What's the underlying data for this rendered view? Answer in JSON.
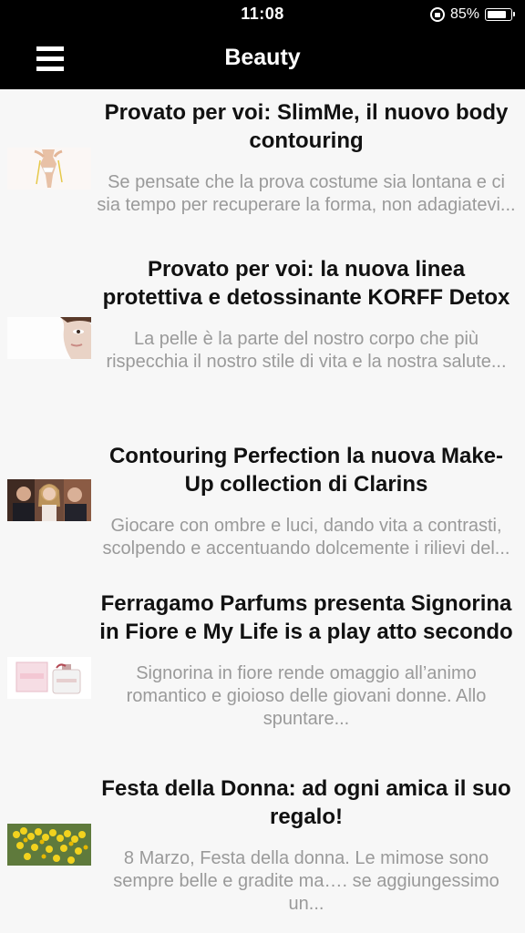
{
  "status_bar": {
    "time": "11:08",
    "battery_percent": "85%",
    "battery_level": 0.85,
    "icons": [
      "rotation-lock-icon",
      "battery-icon"
    ]
  },
  "header": {
    "title": "Beauty",
    "menu_icon": "hamburger-menu-icon"
  },
  "articles": [
    {
      "title": "Provato per voi: SlimMe, il nuovo body contouring",
      "excerpt": "Se pensate che la prova costume sia lontana e ci sia tempo per recuperare la forma, non adagiatevi...",
      "thumb": "body-silhouette-thumbnail"
    },
    {
      "title": "Provato per voi: la nuova linea protettiva e detossinante KORFF Detox",
      "excerpt": "La pelle è la parte del nostro corpo che più rispecchia il nostro stile di vita e la nostra salute...",
      "thumb": "face-close-up-thumbnail"
    },
    {
      "title": "Contouring Perfection la nuova Make-Up collection di Clarins",
      "excerpt": "Giocare con ombre e luci, dando vita a contrasti, scolpendo e accentuando dolcemente i rilievi del...",
      "thumb": "people-portrait-thumbnail"
    },
    {
      "title": "Ferragamo Parfums presenta Signorina in Fiore e My Life is a play atto secondo",
      "excerpt": "Signorina in fiore rende omaggio all’animo romantico e gioioso delle giovani donne. Allo spuntare...",
      "thumb": "perfume-box-thumbnail"
    },
    {
      "title": "Festa della Donna: ad ogni amica il suo regalo!",
      "excerpt": "8 Marzo, Festa della donna. Le mimose sono sempre belle e gradite ma…. se aggiungessimo un...",
      "thumb": "mimosa-flowers-thumbnail"
    }
  ]
}
